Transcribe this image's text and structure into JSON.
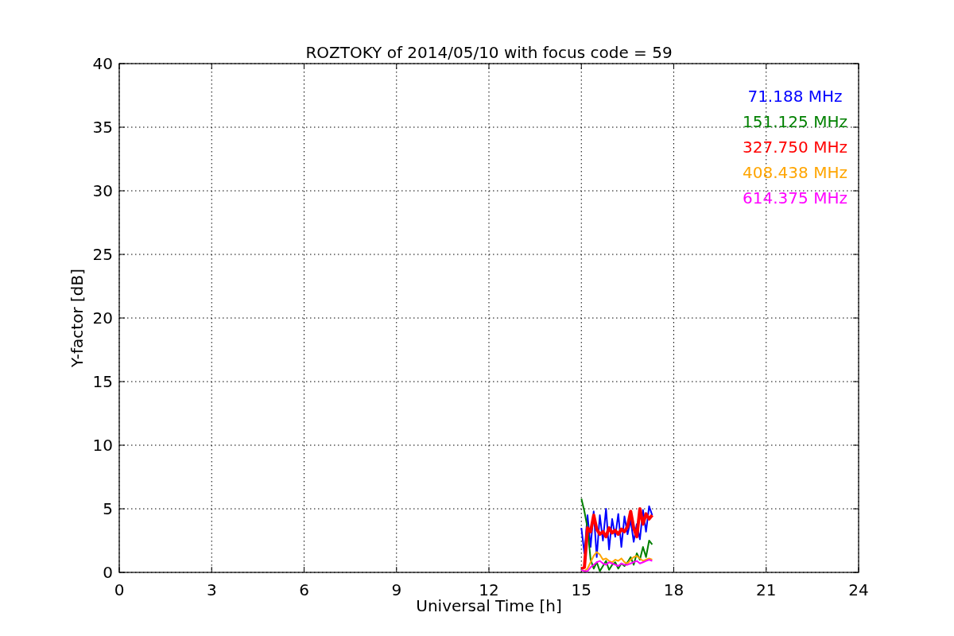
{
  "chart_data": {
    "type": "line",
    "title": "ROZTOKY of 2014/05/10 with focus code = 59",
    "xlabel": "Universal Time [h]",
    "ylabel": "Y-factor [dB]",
    "x": [
      15.0,
      15.1,
      15.2,
      15.3,
      15.4,
      15.5,
      15.6,
      15.7,
      15.8,
      15.9,
      16.0,
      16.1,
      16.2,
      16.3,
      16.4,
      16.5,
      16.6,
      16.7,
      16.8,
      16.9,
      17.0,
      17.1,
      17.2,
      17.3
    ],
    "series": [
      {
        "name": "71.188 MHz",
        "color": "#0000ff",
        "values": [
          3.5,
          1.5,
          4.5,
          2.0,
          4.8,
          1.2,
          4.5,
          2.5,
          5.0,
          1.8,
          4.2,
          2.8,
          4.6,
          2.0,
          4.4,
          3.0,
          4.1,
          2.4,
          3.8,
          2.6,
          4.9,
          3.2,
          5.2,
          4.5
        ]
      },
      {
        "name": "151.125 MHz",
        "color": "#008000",
        "values": [
          5.8,
          4.8,
          3.5,
          1.0,
          0.3,
          0.8,
          0.1,
          0.5,
          0.9,
          0.2,
          0.6,
          0.8,
          0.3,
          0.7,
          0.5,
          0.8,
          1.2,
          0.6,
          1.5,
          1.0,
          2.0,
          1.2,
          2.5,
          2.2
        ]
      },
      {
        "name": "327.750 MHz",
        "color": "#ff0000",
        "values": [
          0.3,
          0.4,
          3.5,
          3.2,
          4.5,
          3.4,
          3.0,
          3.2,
          2.8,
          3.5,
          3.1,
          3.3,
          3.0,
          3.4,
          3.2,
          3.6,
          4.8,
          3.5,
          2.8,
          5.0,
          3.8,
          4.6,
          4.2,
          4.5
        ]
      },
      {
        "name": "408.438 MHz",
        "color": "#ffa500",
        "values": [
          0.2,
          0.1,
          0.3,
          0.8,
          1.3,
          1.6,
          1.4,
          1.0,
          1.1,
          0.9,
          0.8,
          1.0,
          0.9,
          1.1,
          0.8,
          0.7,
          1.0,
          1.2,
          1.3,
          1.1,
          0.9,
          1.0,
          1.1,
          1.0
        ]
      },
      {
        "name": "614.375 MHz",
        "color": "#ff00ff",
        "values": [
          0.2,
          0.1,
          0.1,
          0.4,
          0.6,
          0.8,
          0.9,
          0.7,
          0.6,
          0.8,
          0.7,
          0.6,
          0.5,
          0.7,
          0.6,
          0.6,
          0.7,
          0.8,
          0.9,
          0.7,
          0.8,
          0.9,
          1.0,
          0.9
        ]
      }
    ],
    "grid": true,
    "xlim": [
      0,
      24
    ],
    "ylim": [
      0,
      40
    ],
    "xticks": [
      0,
      3,
      6,
      9,
      12,
      15,
      18,
      21,
      24
    ],
    "yticks": [
      0,
      5,
      10,
      15,
      20,
      25,
      30,
      35,
      40
    ]
  }
}
